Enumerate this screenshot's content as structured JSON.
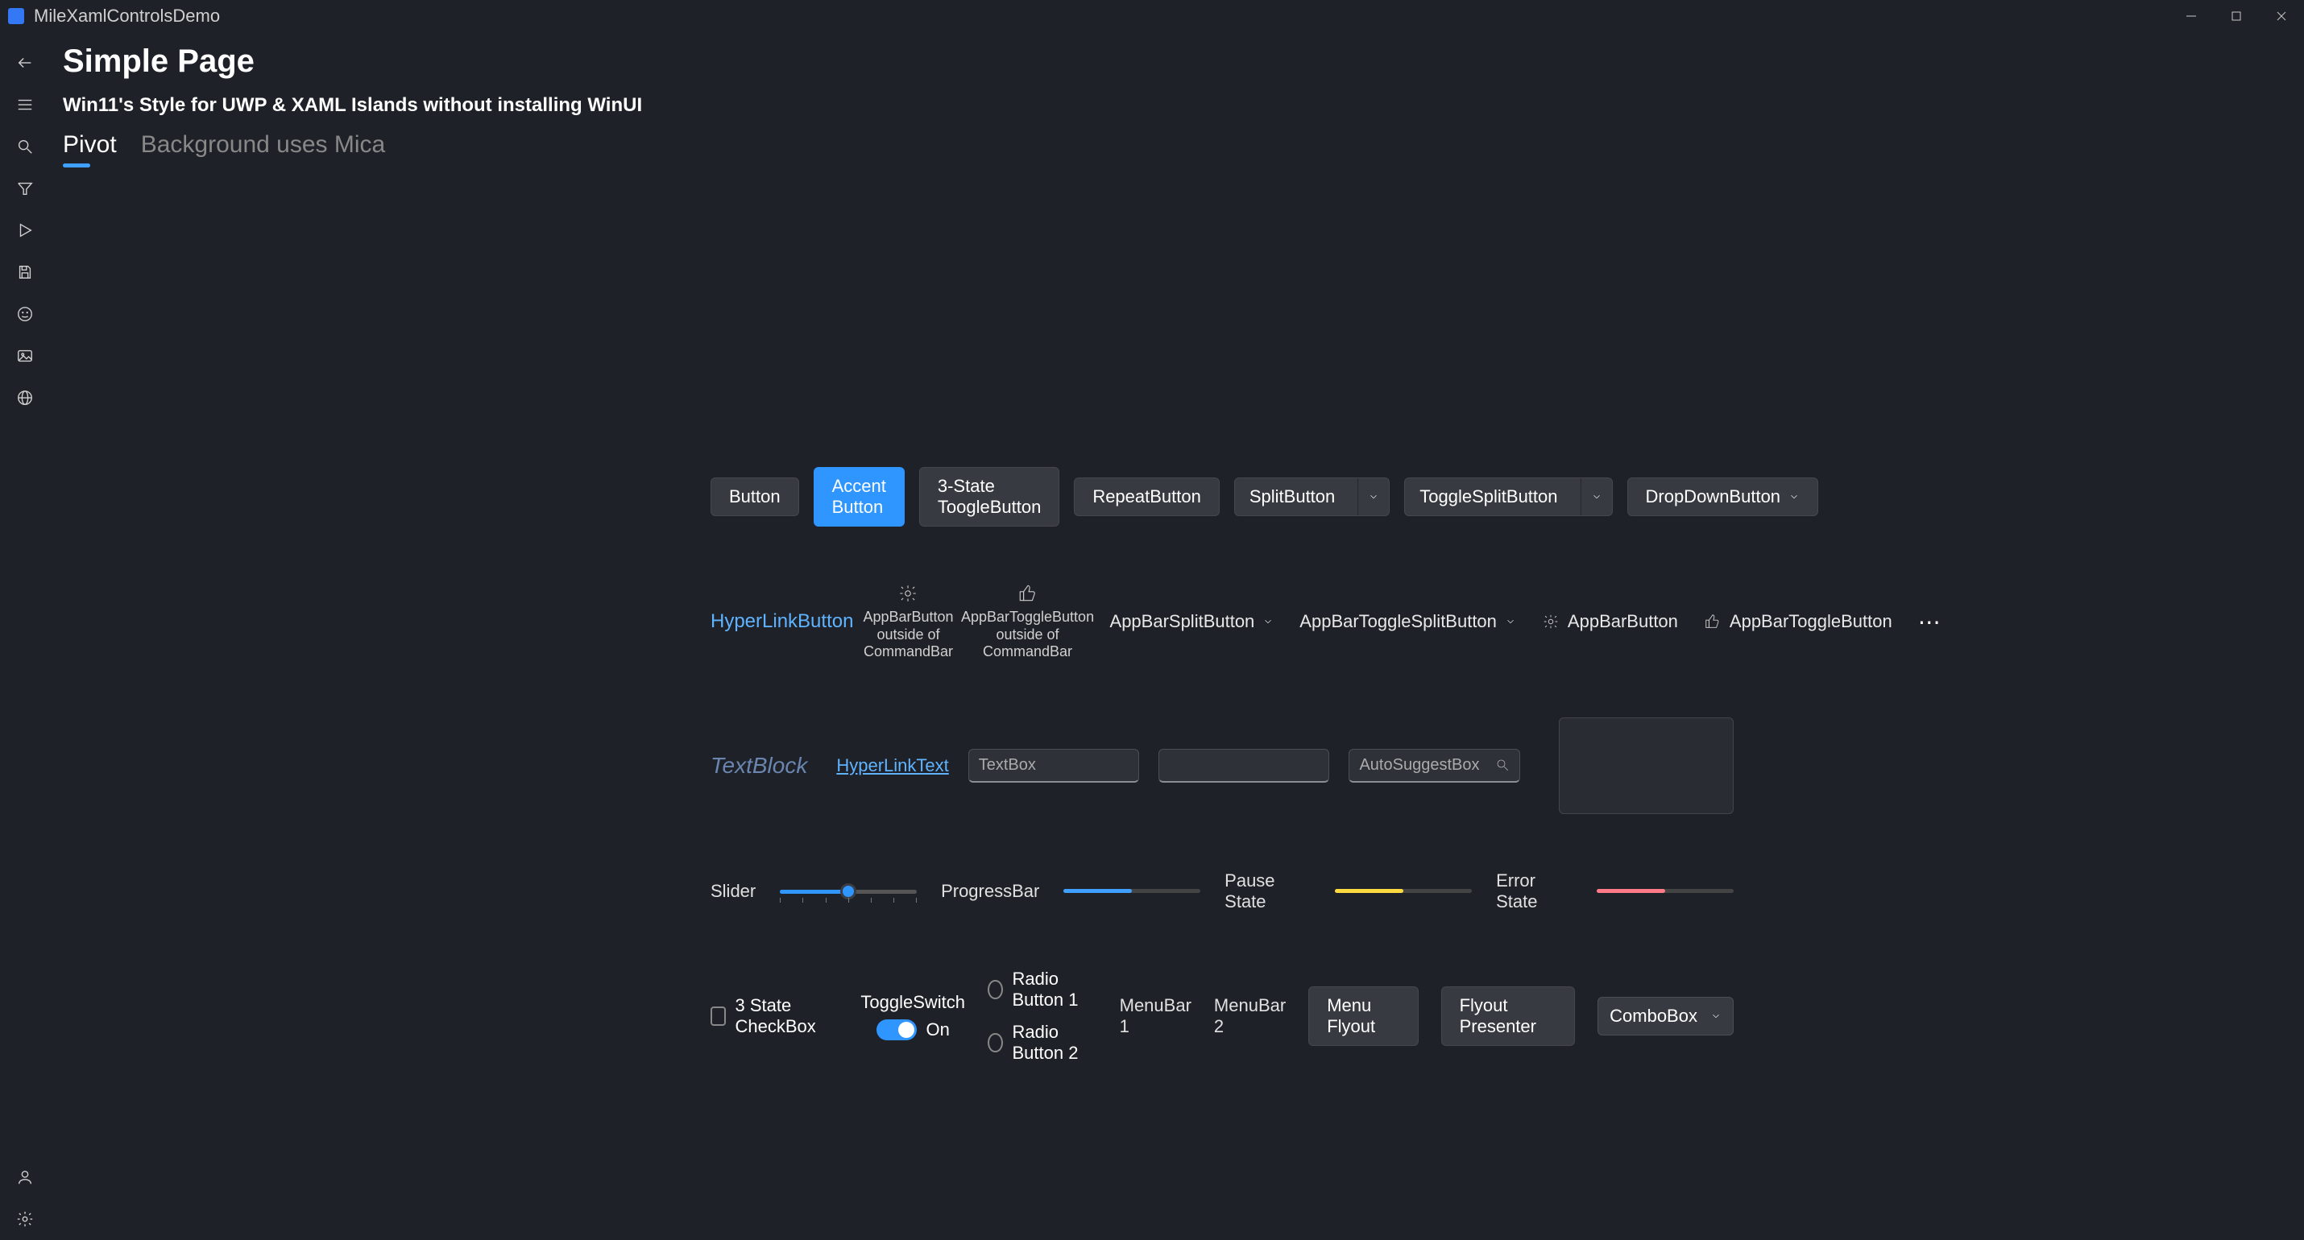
{
  "titlebar": {
    "app_title": "MileXamlControlsDemo"
  },
  "nav": {
    "items": [
      {
        "name": "back",
        "icon": "arrow-left"
      },
      {
        "name": "menu",
        "icon": "menu"
      },
      {
        "name": "search",
        "icon": "search"
      },
      {
        "name": "filter",
        "icon": "filter"
      },
      {
        "name": "play",
        "icon": "play"
      },
      {
        "name": "save",
        "icon": "save"
      },
      {
        "name": "emoji",
        "icon": "smile"
      },
      {
        "name": "image",
        "icon": "image"
      },
      {
        "name": "web",
        "icon": "globe"
      }
    ],
    "bottom": [
      {
        "name": "account",
        "icon": "user"
      },
      {
        "name": "settings",
        "icon": "gear"
      }
    ]
  },
  "header": {
    "title": "Simple Page",
    "subtitle": "Win11's Style for UWP & XAML Islands without installing WinUI"
  },
  "tabs": {
    "items": [
      {
        "label": "Pivot",
        "active": true
      },
      {
        "label": "Background uses Mica",
        "active": false
      }
    ]
  },
  "buttons_row": {
    "button": "Button",
    "accent": "Accent Button",
    "toggle3": "3-State ToogleButton",
    "repeat": "RepeatButton",
    "split": "SplitButton",
    "toggle_split": "ToggleSplitButton",
    "dropdown": "DropDownButton"
  },
  "appbar_row": {
    "hyperlink": "HyperLinkButton",
    "appbarbutton_stack": "AppBarButton outside of CommandBar",
    "appbartoggle_stack": "AppBarToggleButton outside of CommandBar",
    "appbar_split": "AppBarSplitButton",
    "appbar_toggle_split": "AppBarToggleSplitButton",
    "appbar_button": "AppBarButton",
    "appbar_toggle_button": "AppBarToggleButton"
  },
  "text_row": {
    "textblock": "TextBlock",
    "hyperlinktext": "HyperLinkText",
    "textbox_placeholder": "TextBox",
    "autosuggest_placeholder": "AutoSuggestBox"
  },
  "slider_row": {
    "slider_label": "Slider",
    "progressbar_label": "ProgressBar",
    "pause_label": "Pause State",
    "error_label": "Error State",
    "slider_value_percent": 50,
    "progress_percent": 50,
    "pause_percent": 50,
    "error_percent": 50
  },
  "misc_row": {
    "checkbox": "3 State CheckBox",
    "toggleswitch_label": "ToggleSwitch",
    "toggleswitch_state": "On",
    "radio1": "Radio Button 1",
    "radio2": "Radio Button 2",
    "menubar1": "MenuBar 1",
    "menubar2": "MenuBar 2",
    "menu_flyout": "Menu Flyout",
    "flyout_presenter": "Flyout Presenter",
    "combobox": "ComboBox"
  }
}
